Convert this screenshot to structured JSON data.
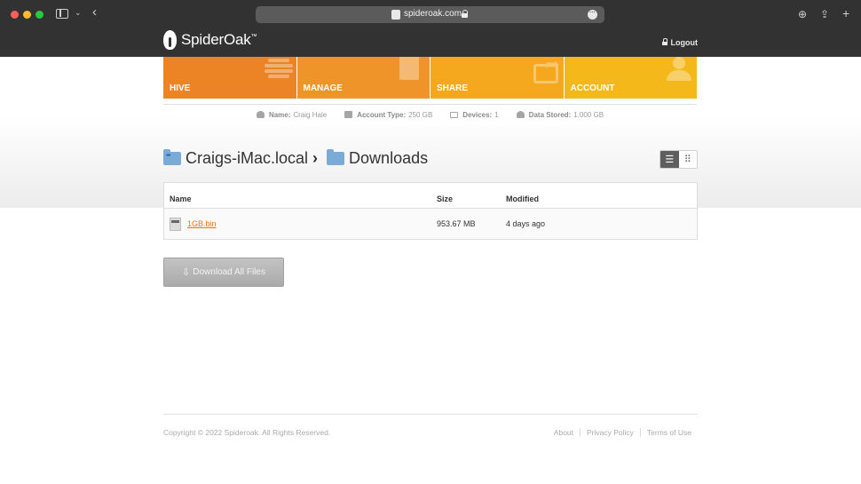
{
  "browser": {
    "url": "spideroak.com"
  },
  "header": {
    "brand": "SpiderOak",
    "logout_label": "Logout"
  },
  "nav": {
    "tiles": [
      {
        "label": "HIVE",
        "color": "#ec8426"
      },
      {
        "label": "MANAGE",
        "color": "#ef9428"
      },
      {
        "label": "SHARE",
        "color": "#f5a81e"
      },
      {
        "label": "ACCOUNT",
        "color": "#f5b81a"
      }
    ]
  },
  "account": {
    "name_label": "Name:",
    "name_value": "Craig Hale",
    "type_label": "Account Type:",
    "type_value": "250 GB",
    "devices_label": "Devices:",
    "devices_value": "1",
    "stored_label": "Data Stored:",
    "stored_value": "1.000 GB"
  },
  "breadcrumb": {
    "device": "Craigs-iMac.local",
    "separator": "›",
    "folder": "Downloads"
  },
  "table": {
    "headers": {
      "name": "Name",
      "size": "Size",
      "modified": "Modified"
    },
    "rows": [
      {
        "name": "1GB.bin",
        "size": "953.67 MB",
        "modified": "4 days ago"
      }
    ]
  },
  "actions": {
    "download_all_label": "Download All Files"
  },
  "footer": {
    "copyright": "Copyright © 2022 Spideroak. All Rights Reserved.",
    "links": [
      "About",
      "Privacy Policy",
      "Terms of Use"
    ]
  }
}
